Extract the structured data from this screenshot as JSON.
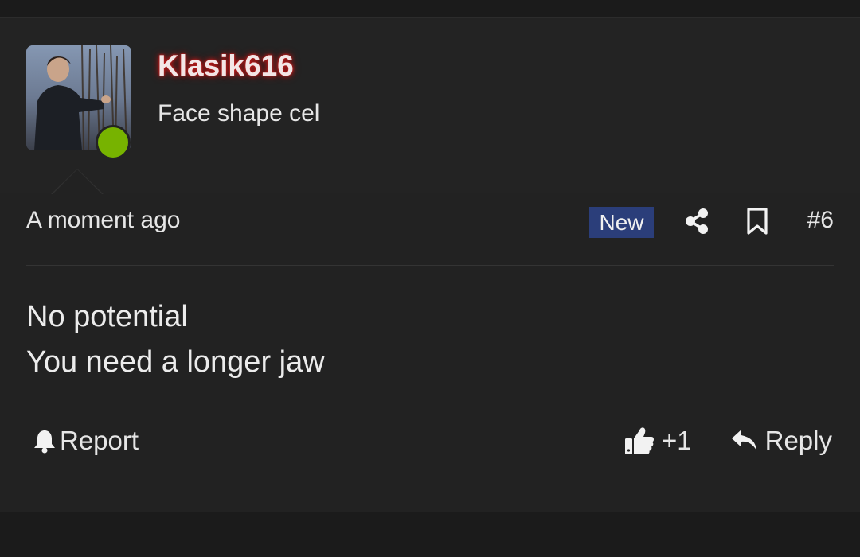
{
  "post": {
    "username": "Klasik616",
    "user_title": "Face shape cel",
    "timestamp": "A moment ago",
    "badge": "New",
    "number": "#6",
    "body_lines": [
      "No potential",
      "You need a longer jaw"
    ],
    "actions": {
      "report_label": "Report",
      "like_label": "+1",
      "reply_label": "Reply"
    },
    "online_status_color": "#77b300",
    "username_glow_color": "#c21a1a",
    "badge_color": "#2b3e7a"
  },
  "icons": {
    "share": "share-icon",
    "bookmark": "bookmark-icon",
    "bell": "bell-icon",
    "thumbs_up": "thumbs-up-icon",
    "reply": "reply-icon"
  }
}
